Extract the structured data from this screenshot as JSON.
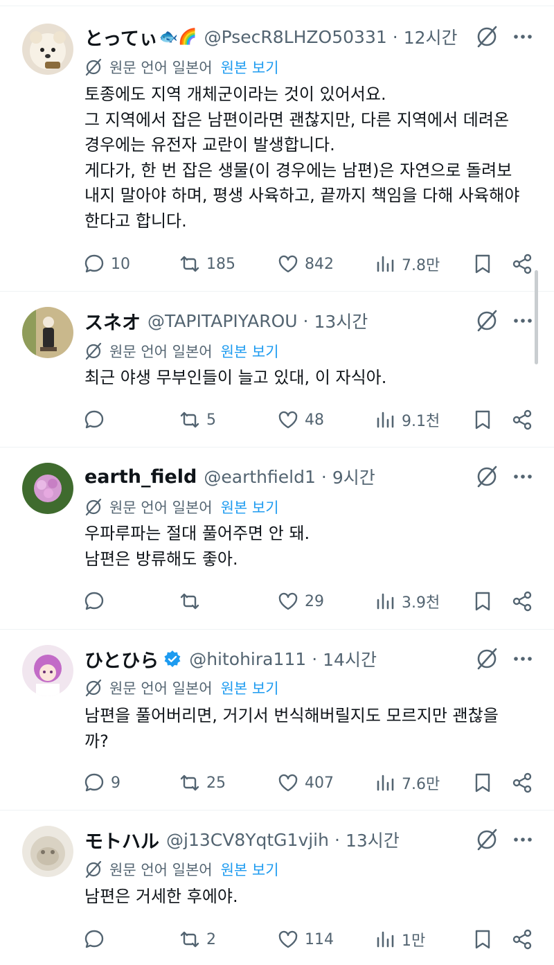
{
  "translate": {
    "label": "원문 언어 일본어",
    "link": "원본 보기"
  },
  "tweets": [
    {
      "name": "とってぃ",
      "name_emoji": "🐟🌈",
      "handle": "@PsecR8LHZO50331",
      "time": "12시간",
      "verified": false,
      "lines": [
        "토종에도 지역 개체군이라는 것이 있어서요.",
        "그 지역에서 잡은 남편이라면 괜찮지만, 다른 지역에서 데려온",
        "경우에는 유전자 교란이 발생합니다.",
        "게다가, 한 번 잡은 생물(이 경우에는 남편)은 자연으로 돌려보",
        "내지 말아야 하며, 평생 사육하고, 끝까지 책임을 다해 사육해야",
        "한다고 합니다."
      ],
      "replies": "10",
      "retweets": "185",
      "likes": "842",
      "views": "7.8만"
    },
    {
      "name": "スネオ",
      "name_emoji": "",
      "handle": "@TAPITAPIYAROU",
      "time": "13시간",
      "verified": false,
      "lines": [
        "최근 야생 무부인들이 늘고 있대, 이 자식아."
      ],
      "replies": "",
      "retweets": "5",
      "likes": "48",
      "views": "9.1천"
    },
    {
      "name": "earth_field",
      "name_emoji": "",
      "handle": "@earthfield1",
      "time": "9시간",
      "verified": false,
      "lines": [
        "우파루파는 절대 풀어주면 안 돼.",
        "남편은 방류해도 좋아."
      ],
      "replies": "",
      "retweets": "",
      "likes": "29",
      "views": "3.9천"
    },
    {
      "name": "ひとひら",
      "name_emoji": "",
      "handle": "@hitohira111",
      "time": "14시간",
      "verified": true,
      "lines": [
        "남편을 풀어버리면, 거기서 번식해버릴지도 모르지만 괜찮을",
        "까?"
      ],
      "replies": "9",
      "retweets": "25",
      "likes": "407",
      "views": "7.6만"
    },
    {
      "name": "モトハル",
      "name_emoji": "",
      "handle": "@j13CV8YqtG1vjih",
      "time": "13시간",
      "verified": false,
      "lines": [
        "남편은 거세한 후에야."
      ],
      "replies": "",
      "retweets": "2",
      "likes": "114",
      "views": "1만"
    }
  ],
  "icons": {
    "grok": "grok-icon",
    "more": "more-icon",
    "reply": "reply-icon",
    "retweet": "retweet-icon",
    "like": "like-icon",
    "views": "views-icon",
    "bookmark": "bookmark-icon",
    "share": "share-icon",
    "translate": "translate-icon",
    "verified": "verified-badge-icon"
  },
  "colors": {
    "text": "#0f1419",
    "secondary": "#536471",
    "link": "#1d9bf0",
    "verified": "#1d9bf0",
    "divider": "#eff3f4"
  }
}
